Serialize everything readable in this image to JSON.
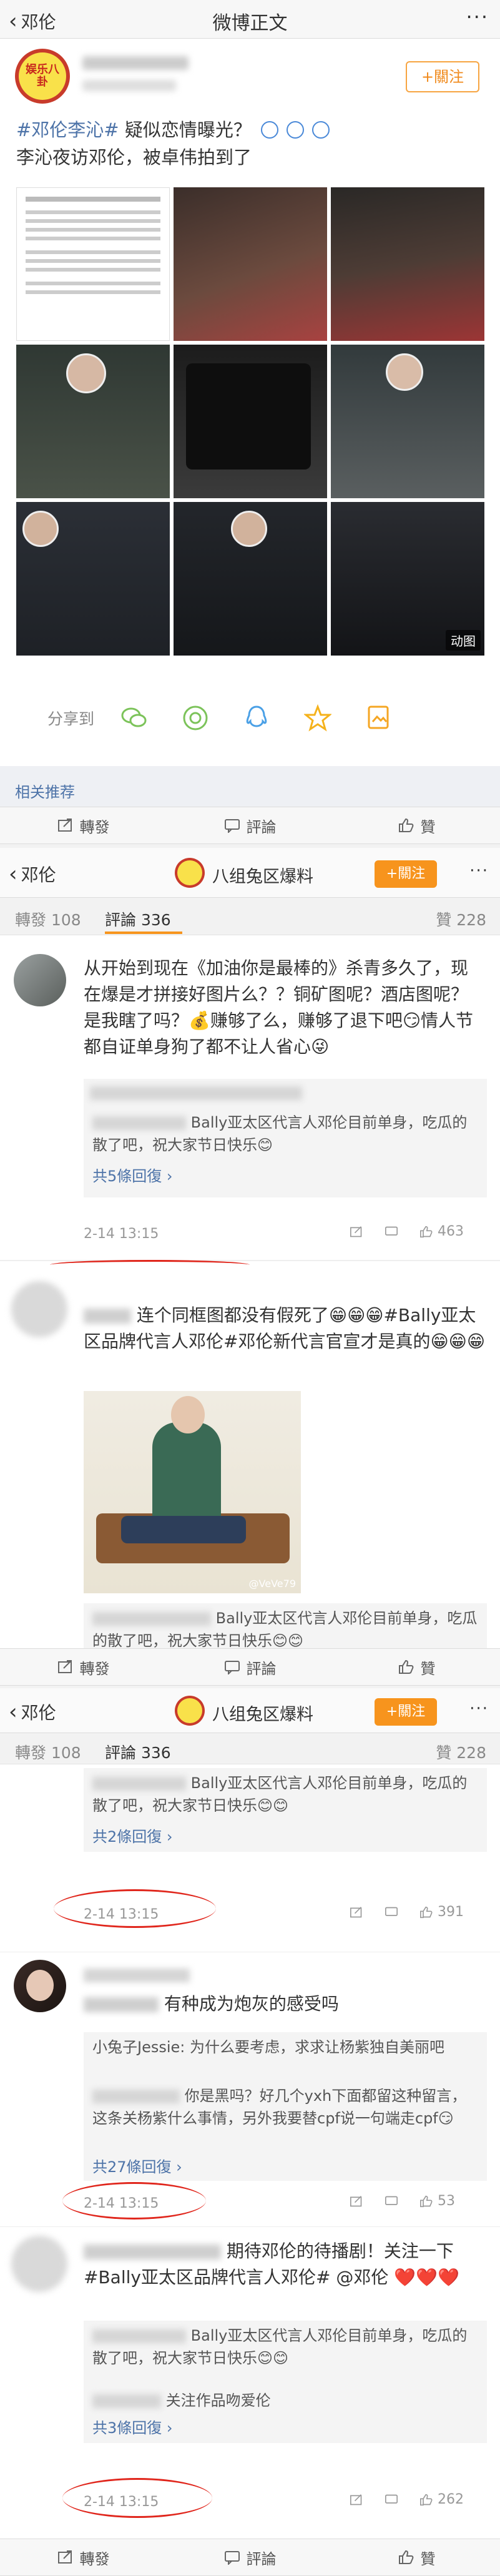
{
  "nav": {
    "back_label": "邓伦",
    "title": "微博正文",
    "more": "···"
  },
  "post": {
    "author_badge": "娱乐八卦",
    "follow_label": "+關注",
    "hashtag": "#邓伦李沁#",
    "line1_rest": " 疑似恋情曝光？",
    "line2": "李沁夜访邓伦，被卓伟拍到了",
    "share_label": "分享到",
    "gif_tag": "动图"
  },
  "related_label": "相关推荐",
  "toolbar": {
    "repost": "轉發",
    "comment": "評論",
    "like": "贊"
  },
  "page2_nav": {
    "back_label": "邓伦",
    "account": "八组兔区爆料",
    "follow_label": "+關注",
    "more": "···"
  },
  "tabs": {
    "repost": "轉發 108",
    "comment": "評論 336",
    "like": "贊 228"
  },
  "comments": [
    {
      "text": "从开始到现在《加油你是最棒的》杀青多久了，现在爆是才拼接好图片么？？铜矿图呢？酒店图呢？是我瞎了吗？💰赚够了么，赚够了退下吧😏情人节都自证单身狗了都不让人省心😜",
      "reply_text": "Bally亚太区代言人邓伦目前单身，吃瓜的散了吧，祝大家节日快乐😊",
      "reply_count": "共5條回復",
      "time": "2-14 13:15",
      "likes": "463"
    },
    {
      "text": "连个同框图都没有假死了😁😁😁#Bally亚太区品牌代言人邓伦#邓伦新代言官宣才是真的😁😁😁",
      "hashtag": "#Bally亚太区品牌代言人邓伦#",
      "watermark": "@VeVe79",
      "reply_text": "Bally亚太区代言人邓伦目前单身，吃瓜的散了吧，祝大家节日快乐😊😊"
    }
  ],
  "page3_comments": [
    {
      "reply_text": "Bally亚太区代言人邓伦目前单身，吃瓜的散了吧，祝大家节日快乐😊😊",
      "reply_count": "共2條回復",
      "time": "2-14 13:15",
      "likes": "391"
    },
    {
      "text": "有种成为炮灰的感受吗",
      "reply_a": "小兔子Jessie: 为什么要考虑，求求让杨紫独自美丽吧",
      "reply_b": "你是黑吗？好几个yxh下面都留这种留言，这条关杨紫什么事情，另外我要替cpf说一句端走cpf😏",
      "reply_count": "共27條回復",
      "time": "2-14 13:15",
      "likes": "53"
    },
    {
      "text": "期待邓伦的待播剧！关注一下#Bally亚太区品牌代言人邓伦# @邓伦 ❤️❤️❤️",
      "reply_a": "Bally亚太区代言人邓伦目前单身，吃瓜的散了吧，祝大家节日快乐😊😊",
      "reply_b": "关注作品吻爱伦",
      "reply_count": "共3條回復",
      "time": "2-14 13:15",
      "likes": "262"
    }
  ]
}
